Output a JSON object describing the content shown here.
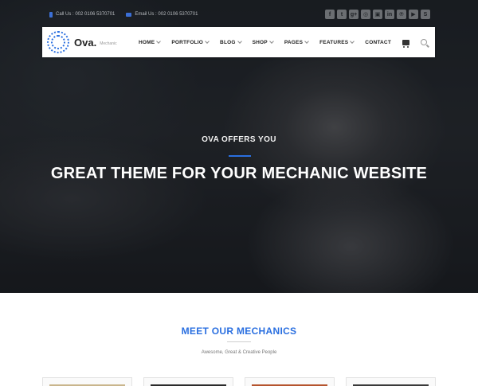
{
  "topbar": {
    "call": "Call Us : 002 0106 5370701",
    "email": "Email Us : 002 0106 5370701",
    "social_icons": [
      "facebook-icon",
      "twitter-icon",
      "google-plus-icon",
      "dribbble-icon",
      "instagram-icon",
      "linkedin-icon",
      "pinterest-icon",
      "youtube-icon",
      "skype-icon"
    ],
    "social_glyphs": [
      "f",
      "t",
      "g+",
      "◎",
      "▣",
      "in",
      "℗",
      "▶",
      "S"
    ]
  },
  "brand": {
    "name": "Ova.",
    "tagline": "Mechanic",
    "accent": "#2a6fe0"
  },
  "nav": {
    "items": [
      {
        "label": "HOME",
        "dropdown": true
      },
      {
        "label": "PORTFOLIO",
        "dropdown": true
      },
      {
        "label": "BLOG",
        "dropdown": true
      },
      {
        "label": "SHOP",
        "dropdown": true
      },
      {
        "label": "PAGES",
        "dropdown": true
      },
      {
        "label": "FEATURES",
        "dropdown": true
      },
      {
        "label": "CONTACT",
        "dropdown": false
      }
    ]
  },
  "hero": {
    "subtitle": "OVA OFFERS YOU",
    "title": "GREAT THEME FOR YOUR MECHANIC WEBSITE"
  },
  "section": {
    "title": "MEET OUR MECHANICS",
    "subtitle": "Awesome, Great & Creative People"
  },
  "cards": [
    {
      "strip_color": "#c9b58c"
    },
    {
      "strip_color": "#2b2b2b"
    },
    {
      "strip_color": "#b5542e"
    },
    {
      "strip_color": "#3a3a3a"
    }
  ]
}
